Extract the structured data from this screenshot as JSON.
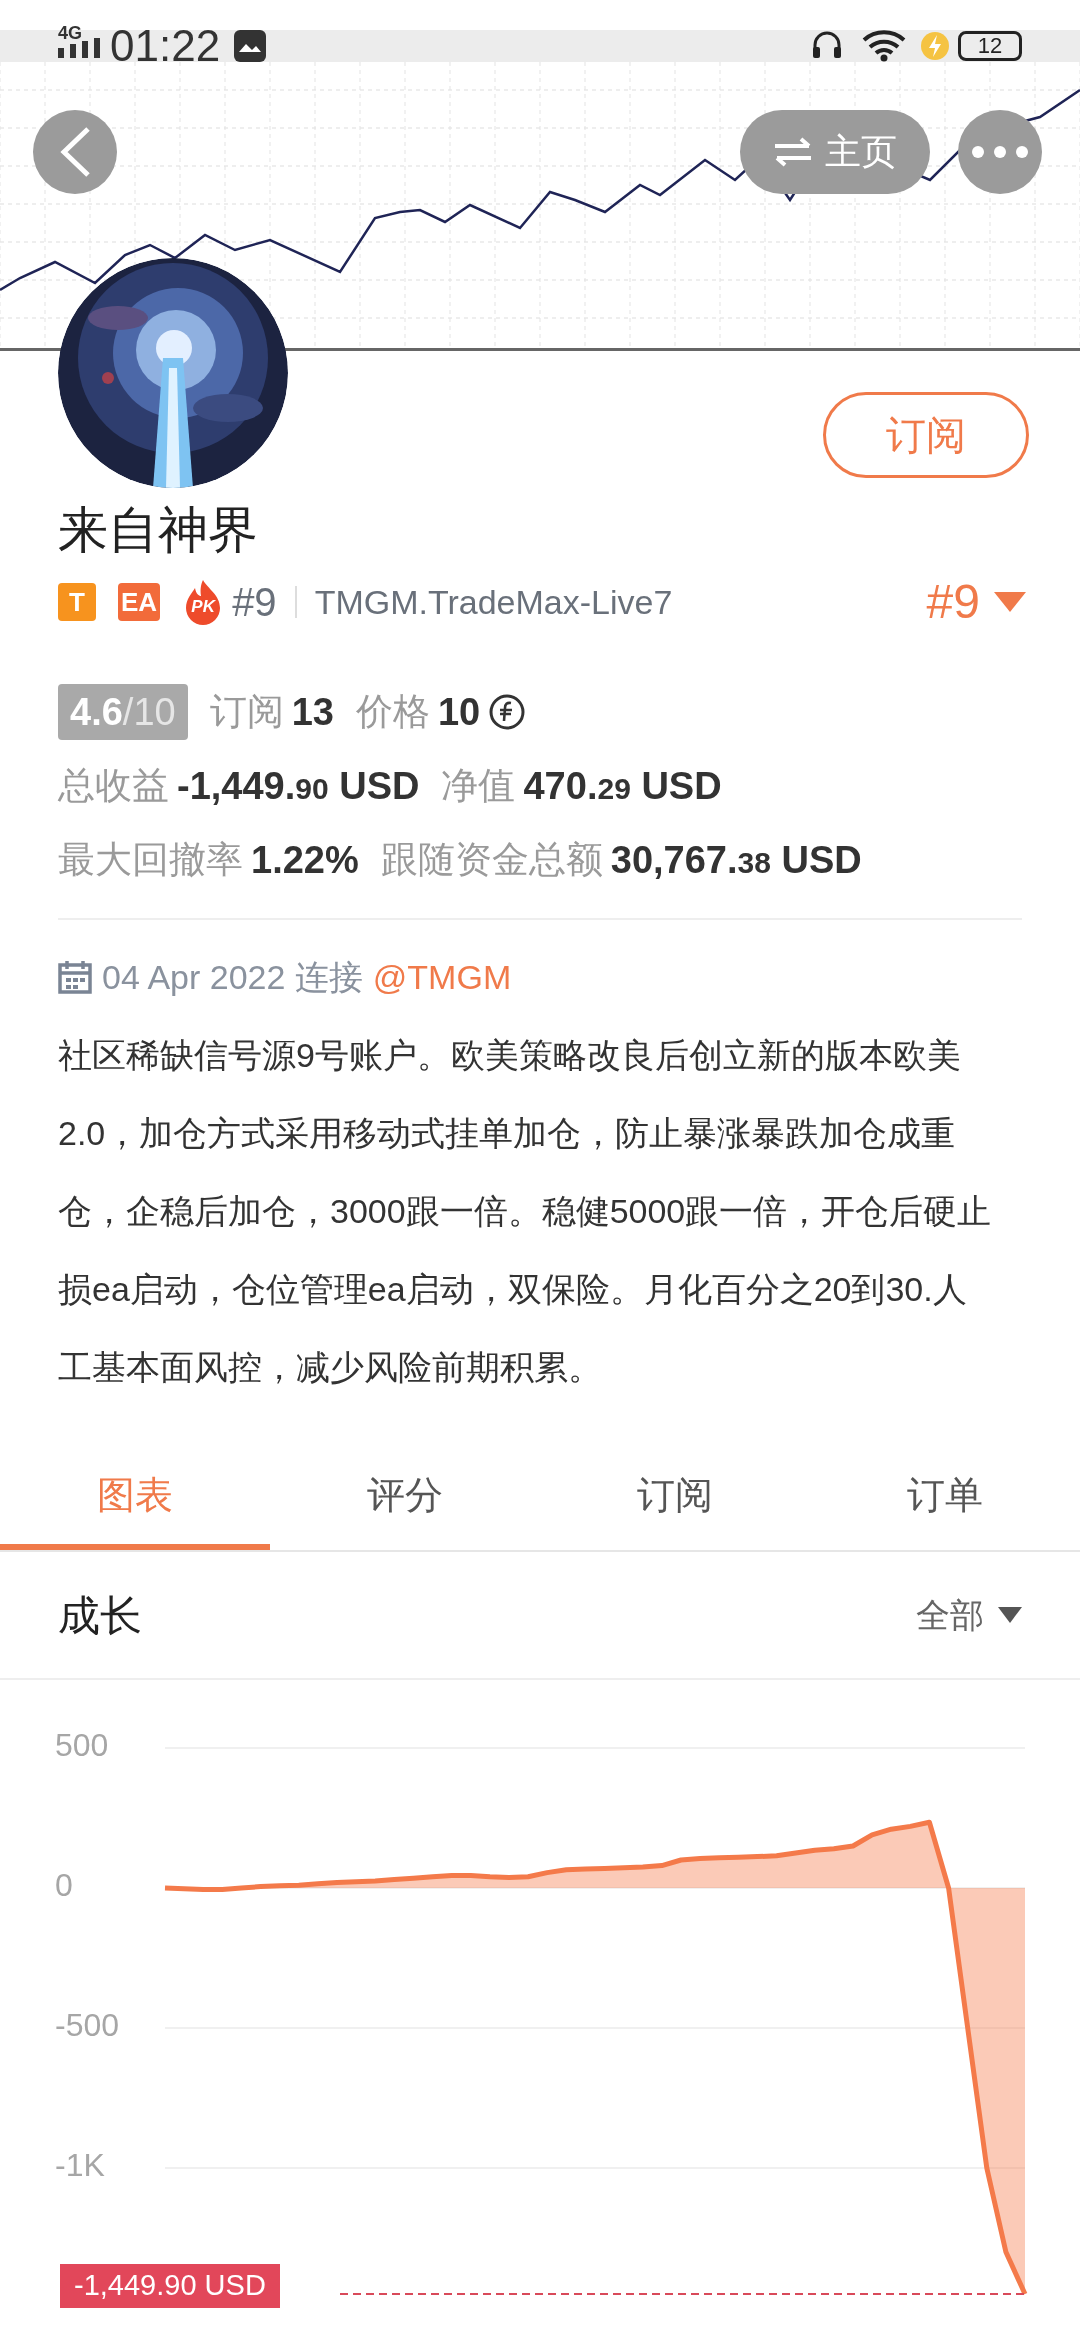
{
  "status_bar": {
    "network": "4G",
    "time": "01:22",
    "battery": "12"
  },
  "header": {
    "home_button": "主页"
  },
  "profile": {
    "subscribe_button": "订阅",
    "name": "来自神界",
    "badges": [
      {
        "kind": "tag",
        "text": "T",
        "color": "#f7931e"
      },
      {
        "kind": "tag",
        "text": "EA",
        "color": "#f26b3a"
      },
      {
        "kind": "pk",
        "text": "PK",
        "color": "#ee4b2b"
      }
    ],
    "rank": "#9",
    "server": "TMGM.TradeMax-Live7",
    "rank_dropdown": "#9"
  },
  "stat_rows": [
    {
      "items": [
        {
          "kind": "rating",
          "value": "4.6",
          "scale": "/10"
        },
        {
          "kind": "count",
          "label": "订阅",
          "value": "13"
        },
        {
          "kind": "coin",
          "label": "价格",
          "value": "10"
        }
      ]
    },
    {
      "items": [
        {
          "kind": "money",
          "label": "总收益",
          "value": "-1,449.",
          "decimals": "90",
          "unit": "USD"
        },
        {
          "kind": "money",
          "label": "净值",
          "value": "470.",
          "decimals": "29",
          "unit": "USD"
        }
      ]
    },
    {
      "items": [
        {
          "kind": "count",
          "label": "最大回撤率",
          "value": "1.22%"
        },
        {
          "kind": "money",
          "label": "跟随资金总额",
          "value": "30,767.",
          "decimals": "38",
          "unit": "USD"
        }
      ]
    }
  ],
  "connection": {
    "date": "04 Apr 2022 连接",
    "link": "@TMGM"
  },
  "description": "社区稀缺信号源9号账户。欧美策略改良后创立新的版本欧美2.0，加仓方式采用移动式挂单加仓，防止暴涨暴跌加仓成重仓，企稳后加仓，3000跟一倍。稳健5000跟一倍，开仓后硬止损ea启动，仓位管理ea启动，双保险。月化百分之20到30.人工基本面风控，减少风险前期积累。",
  "tabs": [
    {
      "label": "图表",
      "selected": true
    },
    {
      "label": "评分",
      "selected": false
    },
    {
      "label": "订阅",
      "selected": false
    },
    {
      "label": "订单",
      "selected": false
    }
  ],
  "section": {
    "filter": "全部"
  },
  "chart_data": {
    "type": "area",
    "categories": [
      null,
      null,
      null,
      null,
      null,
      null,
      null,
      null,
      null,
      null,
      null,
      null,
      null,
      null,
      null,
      null,
      null,
      null,
      null,
      null,
      null,
      null,
      null,
      null,
      null,
      null,
      null,
      null,
      null,
      null,
      null,
      null,
      null,
      null,
      null,
      null,
      null,
      null,
      null,
      null,
      null,
      null,
      null,
      null,
      null,
      null
    ],
    "series": [
      {
        "name": "成长",
        "color": "#f47a4a",
        "values": [
          0,
          -3,
          -5,
          -5,
          0,
          5,
          8,
          10,
          15,
          20,
          22,
          25,
          30,
          35,
          40,
          45,
          45,
          40,
          38,
          40,
          55,
          65,
          68,
          70,
          72,
          75,
          80,
          100,
          105,
          108,
          110,
          112,
          115,
          125,
          135,
          140,
          150,
          190,
          210,
          220,
          235,
          0,
          -500,
          -1000,
          -1300,
          -1450
        ]
      }
    ],
    "ylim": [
      -1450,
      500
    ],
    "grid": true,
    "yticks": [
      {
        "value": 500,
        "label": "500"
      },
      {
        "value": 0,
        "label": "0"
      },
      {
        "value": -500,
        "label": "-500"
      },
      {
        "value": -1000,
        "label": "-1K"
      }
    ],
    "annotations": [
      {
        "text": "-1,449.90 USD"
      }
    ]
  }
}
